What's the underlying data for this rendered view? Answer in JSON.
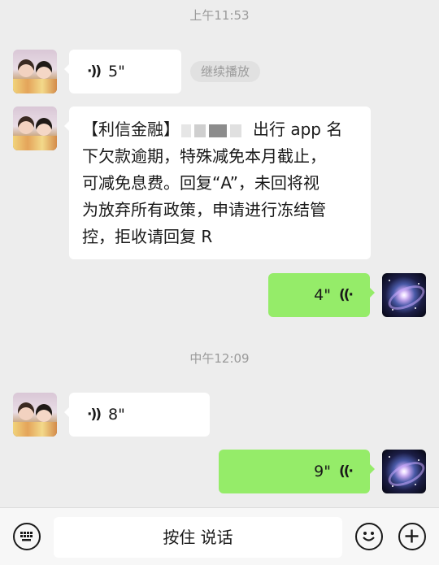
{
  "chat": {
    "timestamp1": "上午11:53",
    "timestamp2": "中午12:09",
    "continue_play": "继续播放",
    "messages": [
      {
        "voice_duration": "5\""
      },
      {
        "sender_prefix": "【利信金融】",
        "sender_suffix": "出行 app 名",
        "lines": [
          "下欠款逾期，特殊减免本月截止，",
          "可减免息费。回复“A”，未回将视",
          "为放弃所有政策，申请进行冻结管",
          "控，拒收请回复 R"
        ]
      },
      {
        "voice_duration": "4\""
      },
      {
        "voice_duration": "8\""
      },
      {
        "voice_duration": "9\""
      }
    ]
  },
  "inputbar": {
    "hold_to_talk": "按住 说话"
  },
  "icons": {
    "voice_in": "voice-wave-left-icon",
    "voice_out": "voice-wave-right-icon",
    "keyboard": "keyboard-icon",
    "emoji": "emoji-icon",
    "add": "plus-icon"
  },
  "colors": {
    "background": "#ededed",
    "incoming_bubble": "#ffffff",
    "outgoing_bubble": "#95ec69"
  }
}
